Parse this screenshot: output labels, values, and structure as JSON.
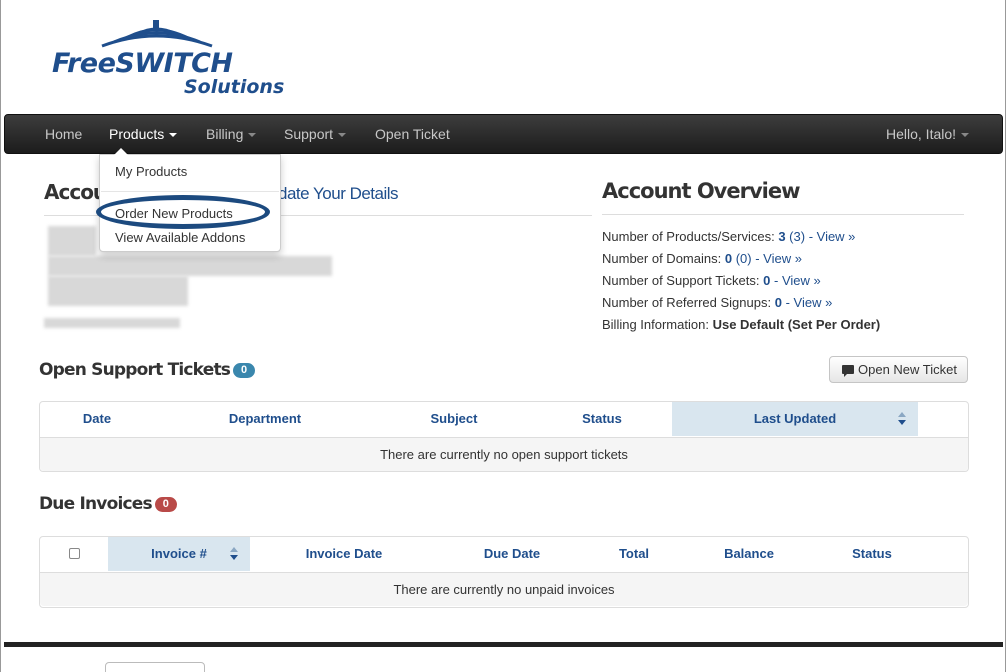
{
  "logo": {
    "line1": "FreeSWITCH",
    "line2": "Solutions"
  },
  "navbar": {
    "items": [
      {
        "label": "Home"
      },
      {
        "label": "Products"
      },
      {
        "label": "Billing"
      },
      {
        "label": "Support"
      },
      {
        "label": "Open Ticket"
      }
    ],
    "user": "Hello, Italo!"
  },
  "products_menu": {
    "items": [
      {
        "label": "My Products"
      },
      {
        "label": "Order New Products"
      },
      {
        "label": "View Available Addons"
      }
    ]
  },
  "account": {
    "heading": "Accou",
    "update_link": "date Your Details"
  },
  "overview": {
    "heading": "Account Overview",
    "products_label": "Number of Products/Services:",
    "products_count": "3",
    "products_sub": "(3)",
    "domains_label": "Number of Domains:",
    "domains_count": "0",
    "domains_sub": "(0)",
    "tickets_label": "Number of Support Tickets:",
    "tickets_count": "0",
    "referred_label": "Number of Referred Signups:",
    "referred_count": "0",
    "view_link": "- View »",
    "billing_label": "Billing Information:",
    "billing_value": "Use Default (Set Per Order)"
  },
  "tickets": {
    "heading": "Open Support Tickets",
    "badge": "0",
    "button": "Open New Ticket",
    "columns": [
      "Date",
      "Department",
      "Subject",
      "Status",
      "Last Updated"
    ],
    "empty": "There are currently no open support tickets"
  },
  "invoices": {
    "heading": "Due Invoices",
    "badge": "0",
    "columns": [
      "Invoice #",
      "Invoice Date",
      "Due Date",
      "Total",
      "Balance",
      "Status"
    ],
    "empty": "There are currently no unpaid invoices"
  },
  "colors": {
    "brand": "#1f4e8c",
    "navbar": "#2a2a2a",
    "badge_blue": "#3a87ad",
    "badge_red": "#b94a48"
  }
}
